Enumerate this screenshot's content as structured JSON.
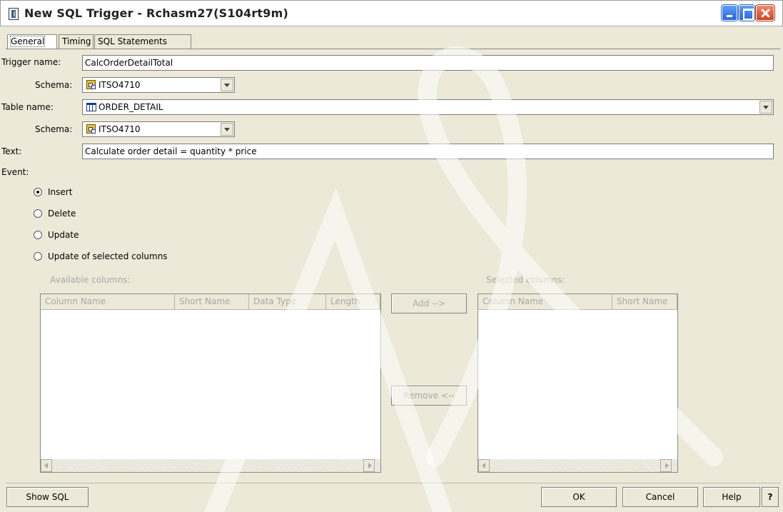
{
  "window": {
    "title": "New SQL Trigger - Rchasm27(S104rt9m)"
  },
  "tabs": [
    {
      "label": "General"
    },
    {
      "label": "Timing"
    },
    {
      "label": "SQL Statements"
    }
  ],
  "form": {
    "trigger_name_label": "Trigger name:",
    "trigger_name_value": "CalcOrderDetailTotal",
    "schema_label": "Schema:",
    "trigger_schema_value": "ITSO4710",
    "table_name_label": "Table name:",
    "table_name_value": "ORDER_DETAIL",
    "table_schema_value": "ITSO4710",
    "text_label": "Text:",
    "text_value": "Calculate order detail = quantity * price",
    "event_label": "Event:"
  },
  "events": [
    {
      "label": "Insert",
      "selected": true
    },
    {
      "label": "Delete",
      "selected": false
    },
    {
      "label": "Update",
      "selected": false
    },
    {
      "label": "Update of selected columns",
      "selected": false
    }
  ],
  "available": {
    "label": "Available columns:",
    "headers": [
      "Column Name",
      "Short Name",
      "Data Type",
      "Length"
    ]
  },
  "selected": {
    "label": "Selected columns:",
    "headers": [
      "Column Name",
      "Short Name"
    ]
  },
  "buttons": {
    "add": "Add -->",
    "remove": "Remove <--",
    "show_sql": "Show SQL",
    "ok": "OK",
    "cancel": "Cancel",
    "help": "Help",
    "context_help": "?"
  }
}
